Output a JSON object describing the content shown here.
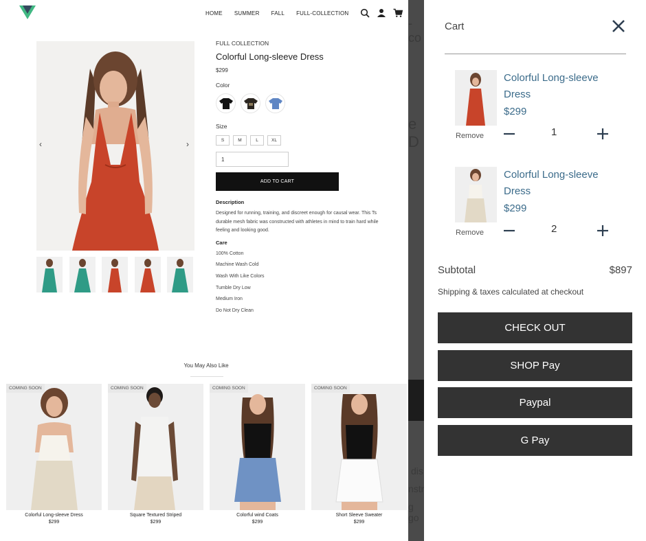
{
  "header": {
    "nav": [
      "HOME",
      "SUMMER",
      "FALL",
      "FULL-COLLECTION"
    ],
    "icons": [
      "search-icon",
      "user-icon",
      "cart-icon"
    ]
  },
  "product": {
    "breadcrumb": "FULL COLLECTION",
    "title": "Colorful Long-sleeve Dress",
    "price": "$299",
    "color_label": "Color",
    "size_label": "Size",
    "sizes": [
      "S",
      "M",
      "L",
      "XL"
    ],
    "quantity": "1",
    "add_to_cart": "ADD TO CART",
    "description_title": "Description",
    "description": "Designed for running, training, and discreet enough for causal wear. This Ts durable mesh fabric was constructed with athletes in mind to train hard while feeling and looking good.",
    "care_title": "Care",
    "care": [
      "100% Cotton",
      "Machine Wash Cold",
      "Wash With Like Colors",
      "Tumble Dry Low",
      "Medium Iron",
      "Do Not Dry Clean"
    ]
  },
  "recommend": {
    "title": "You May Also Like",
    "items": [
      {
        "badge": "COMING SOON",
        "name": "Colorful Long-sleeve Dress",
        "price": "$299"
      },
      {
        "badge": "COMING SOON",
        "name": "Square Textured Striped",
        "price": "$299"
      },
      {
        "badge": "COMING SOON",
        "name": "Colorful wind Coats",
        "price": "$299"
      },
      {
        "badge": "COMING SOON",
        "name": "Short Sleeve Sweater",
        "price": "$299"
      }
    ]
  },
  "background_fragments": [
    "-co",
    "e D",
    "dis",
    "nstr",
    "g go"
  ],
  "cart": {
    "title": "Cart",
    "items": [
      {
        "name": "Colorful Long-sleeve Dress",
        "price": "$299",
        "qty": "1",
        "remove": "Remove"
      },
      {
        "name": "Colorful Long-sleeve Dress",
        "price": "$299",
        "qty": "2",
        "remove": "Remove"
      }
    ],
    "subtotal_label": "Subtotal",
    "subtotal_value": "$897",
    "shipping_note": "Shipping & taxes calculated at checkout",
    "buttons": [
      "CHECK OUT",
      "SHOP Pay",
      "Paypal",
      "G Pay"
    ]
  },
  "colors": {
    "accent_green": "#41b883",
    "dark_green": "#35495e",
    "dress_red": "#c8442a",
    "dress_teal": "#2f9b86",
    "cart_text": "#3b6b8a",
    "button_dark": "#333333"
  }
}
